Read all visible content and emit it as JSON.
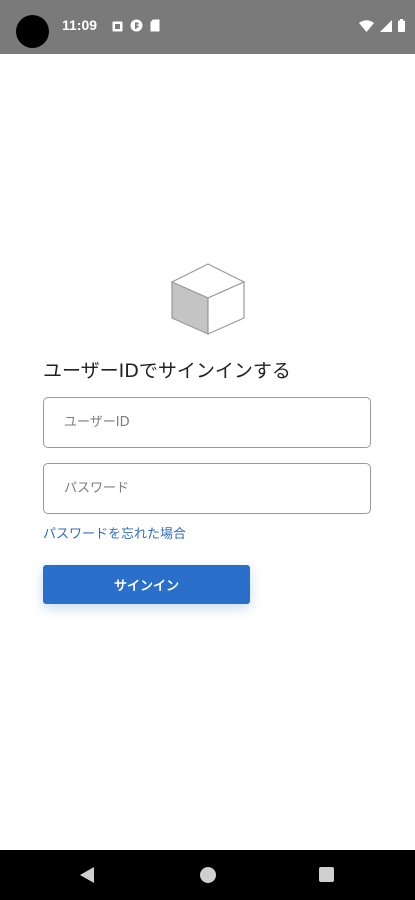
{
  "status_bar": {
    "time": "11:09",
    "left_icons": [
      "notification-icon",
      "app-icon",
      "sd-card-icon"
    ],
    "right_icons": [
      "wifi-icon",
      "signal-icon",
      "battery-icon"
    ]
  },
  "login": {
    "title": "ユーザーIDでサインインする",
    "username_placeholder": "ユーザーID",
    "password_placeholder": "パスワード",
    "forgot_password": "パスワードを忘れた場合",
    "signin_label": "サインイン"
  },
  "colors": {
    "status_bar": "#7a7a7a",
    "accent": "#2a6fc9",
    "link": "#2f6ebd"
  },
  "nav_bar": {
    "icons": [
      "back-icon",
      "home-icon",
      "recents-icon"
    ]
  }
}
